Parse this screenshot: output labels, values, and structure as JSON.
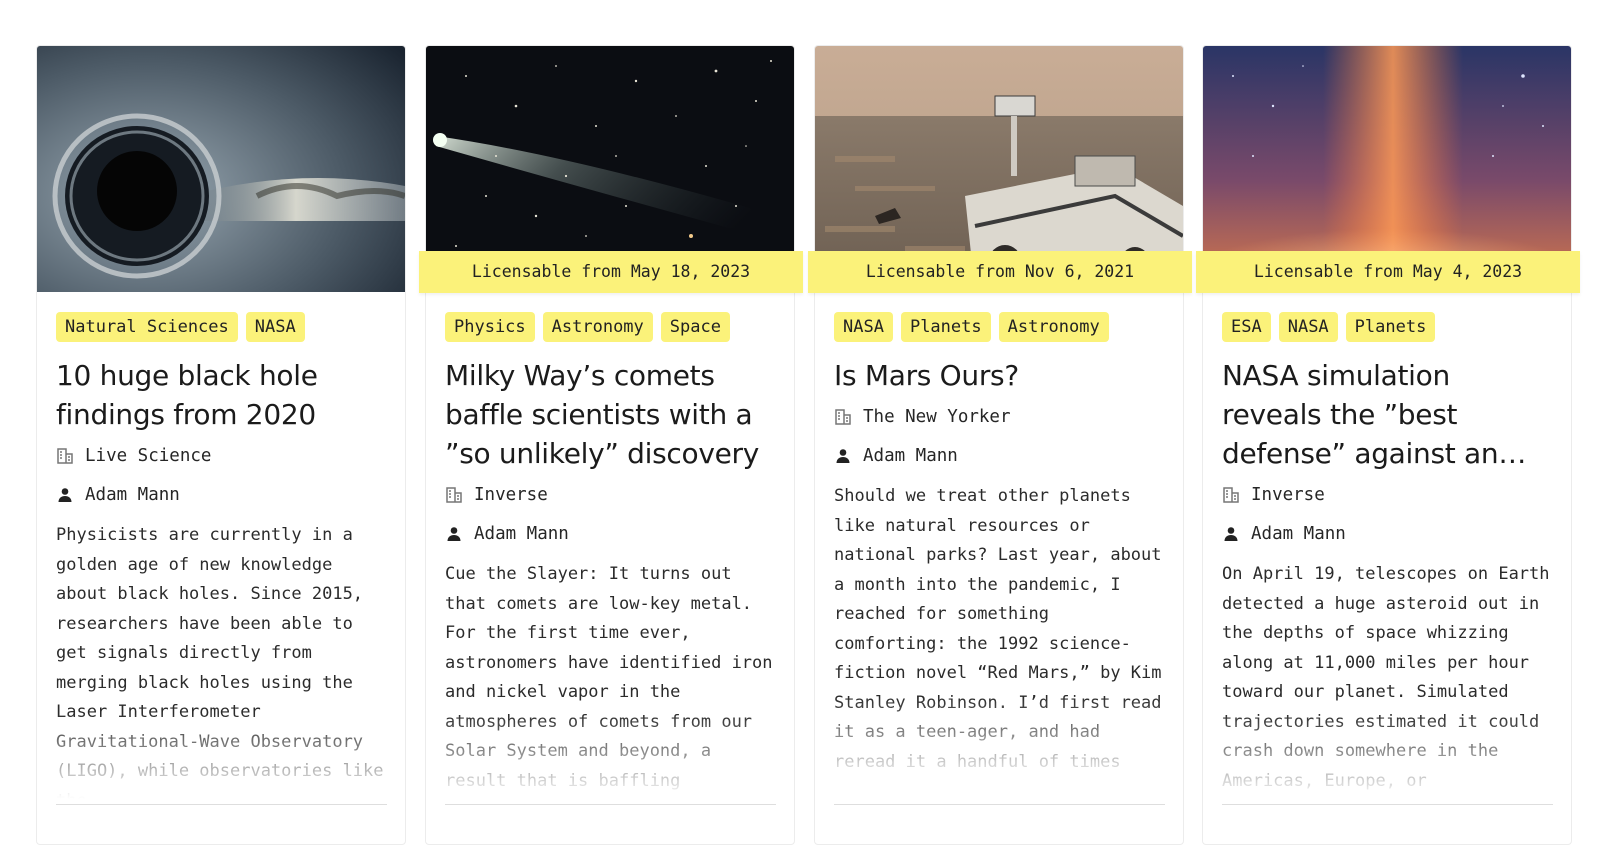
{
  "cards": [
    {
      "licensable": "",
      "tags": [
        "Natural Sciences",
        "NASA"
      ],
      "title": "10 huge black hole findings from 2020",
      "source": "Live Science",
      "author": "Adam Mann",
      "excerpt": "Physicists are currently in a golden age of new knowledge about black holes. Since 2015, researchers have been able to get signals directly from merging black holes using the Laser Interferometer Gravitational-Wave Observatory (LIGO), while observatories like the",
      "image_icon": "black-hole-image"
    },
    {
      "licensable": "Licensable from May 18, 2023",
      "tags": [
        "Physics",
        "Astronomy",
        "Space"
      ],
      "title": "Milky Way’s comets baffle scientists with a ”so unlikely” discovery",
      "source": "Inverse",
      "author": "Adam Mann",
      "excerpt": "Cue the Slayer: It turns out that comets are low-key metal. For the first time ever, astronomers have identified iron and nickel vapor in the atmospheres of comets from our Solar System and beyond, a result that is baffling researchers",
      "image_icon": "comet-image"
    },
    {
      "licensable": "Licensable from Nov 6, 2021",
      "tags": [
        "NASA",
        "Planets",
        "Astronomy"
      ],
      "title": "Is Mars Ours?",
      "source": "The New Yorker",
      "author": "Adam Mann",
      "excerpt": "Should we treat other planets like natural resources or national parks? Last year, about a month into the pandemic, I reached for something comforting: the 1992 science-fiction novel “Red Mars,” by Kim Stanley Robinson. I’d first read it as a teen-ager, and had reread it a handful of times",
      "image_icon": "mars-rover-image"
    },
    {
      "licensable": "Licensable from May 4, 2023",
      "tags": [
        "ESA",
        "NASA",
        "Planets"
      ],
      "title": "NASA simulation reveals the ”best defense” against an…",
      "source": "Inverse",
      "author": "Adam Mann",
      "excerpt": "On April 19, telescopes on Earth detected a huge asteroid out in the depths of space whizzing along at 11,000 miles per hour toward our planet. Simulated trajectories estimated it could crash down somewhere in the Americas, Europe, or",
      "image_icon": "asteroid-image"
    }
  ]
}
